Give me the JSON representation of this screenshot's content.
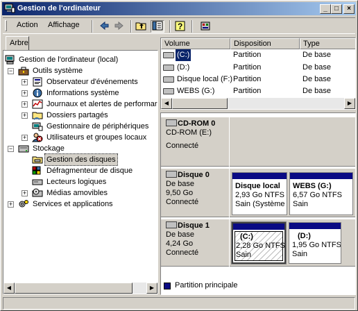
{
  "window": {
    "title": "Gestion de l'ordinateur",
    "minimize_glyph": "_",
    "maximize_glyph": "□",
    "close_glyph": "×"
  },
  "menu": {
    "action": "Action",
    "view": "Affichage"
  },
  "toolbar": {
    "icons": [
      "back-arrow-icon",
      "forward-arrow-icon",
      "up-folder-icon",
      "show-hide-tree-icon",
      "help-icon",
      "properties-icon"
    ]
  },
  "tab": {
    "label": "Arbre"
  },
  "tree": {
    "root": "Gestion de l'ordinateur (local)",
    "system_tools": "Outils système",
    "event_viewer": "Observateur d'événements",
    "system_info": "Informations système",
    "perf_logs": "Journaux et alertes de performar",
    "shared_folders": "Dossiers partagés",
    "device_manager": "Gestionnaire de périphériques",
    "local_users": "Utilisateurs et groupes locaux",
    "storage": "Stockage",
    "disk_mgmt": "Gestion des disques",
    "defrag": "Défragmenteur de disque",
    "logical_drives": "Lecteurs logiques",
    "removable": "Médias amovibles",
    "services": "Services et applications"
  },
  "volumes": {
    "columns": [
      "Volume",
      "Disposition",
      "Type"
    ],
    "rows": [
      {
        "volume": "(C:)",
        "layout": "Partition",
        "type": "De base"
      },
      {
        "volume": "(D:)",
        "layout": "Partition",
        "type": "De base"
      },
      {
        "volume": "Disque local (F:)",
        "layout": "Partition",
        "type": "De base"
      },
      {
        "volume": "WEBS (G:)",
        "layout": "Partition",
        "type": "De base"
      }
    ]
  },
  "disks": {
    "cdrom": {
      "name": "CD-ROM 0",
      "drive": "CD-ROM (E:)",
      "status": "Connecté"
    },
    "disk0": {
      "name": "Disque 0",
      "type": "De base",
      "size": "9,50 Go",
      "status": "Connecté",
      "parts": [
        {
          "name": "Disque local",
          "size": "2,93 Go NTFS",
          "status": "Sain (Système"
        },
        {
          "name": "WEBS  (G:)",
          "size": "6,57 Go NTFS",
          "status": "Sain"
        }
      ]
    },
    "disk1": {
      "name": "Disque 1",
      "type": "De base",
      "size": "4,24 Go",
      "status": "Connecté",
      "parts": [
        {
          "name": "(C:)",
          "size": "2,28 Go NTFS",
          "status": "Sain"
        },
        {
          "name": "(D:)",
          "size": "1,95 Go NTFS",
          "status": "Sain"
        }
      ]
    }
  },
  "legend": {
    "primary": "Partition principale",
    "primary_color": "#0a0a84"
  },
  "colors": {
    "title_start": "#0a246a",
    "title_end": "#a6caf0",
    "face": "#d4d0c8"
  }
}
